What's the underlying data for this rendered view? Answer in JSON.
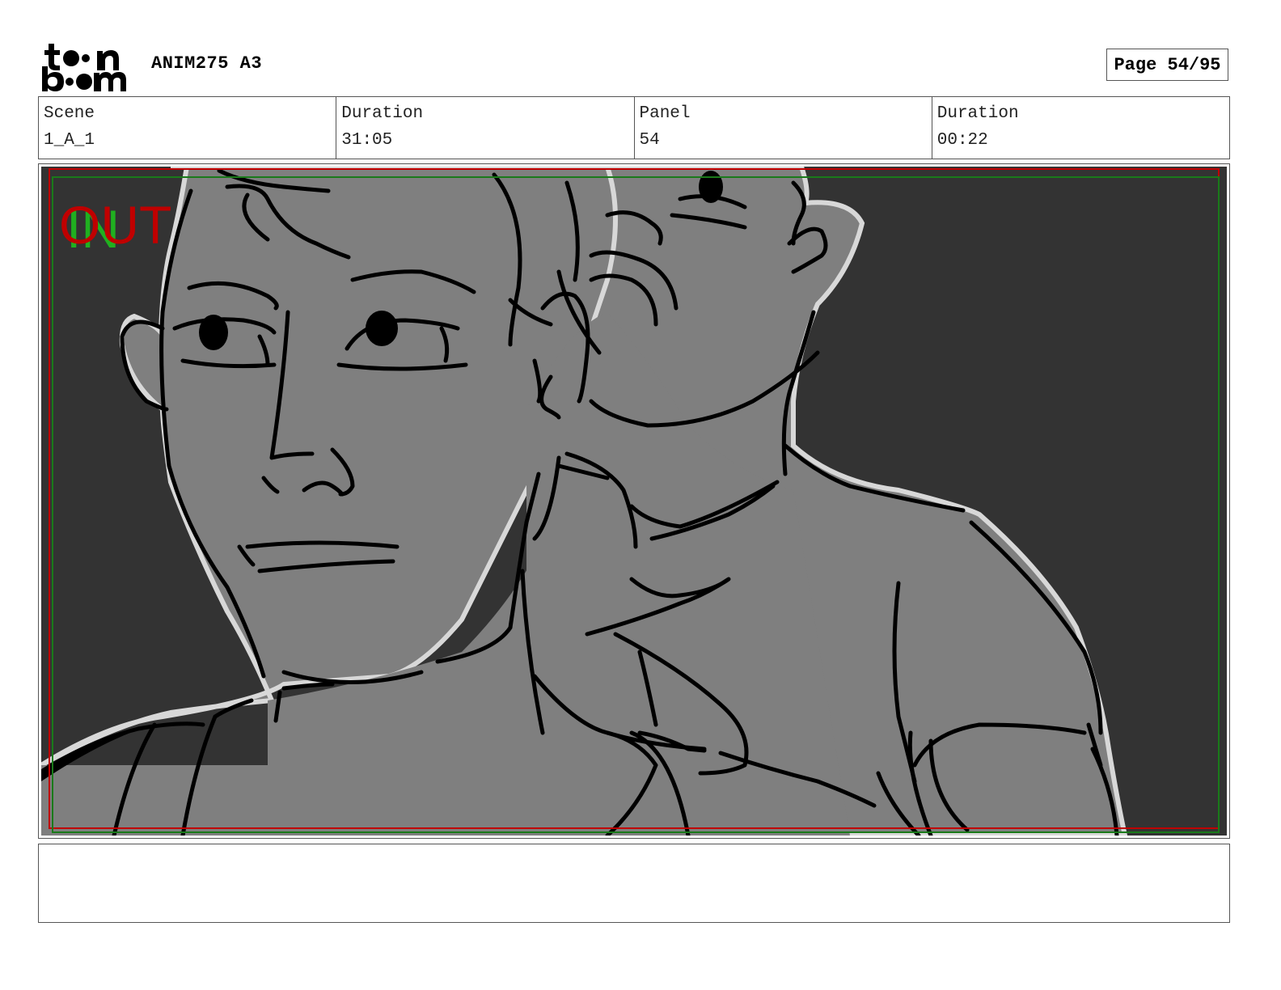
{
  "header": {
    "logo_text_top": "toon",
    "logo_text_bottom": "boom",
    "title": "ANIM275 A3",
    "page_label": "Page 54/95"
  },
  "info": {
    "scene_label": "Scene",
    "scene_value": "1_A_1",
    "scene_duration_label": "Duration",
    "scene_duration_value": "31:05",
    "panel_label": "Panel",
    "panel_value": "54",
    "panel_duration_label": "Duration",
    "panel_duration_value": "00:22"
  },
  "panel": {
    "out_marker": "OUT",
    "in_marker": "IN"
  },
  "notes": {
    "text": ""
  },
  "colors": {
    "background_dark": "#333333",
    "figure_fill": "#7f7f7f",
    "out_frame": "#c00000",
    "in_frame": "#1a7a1a"
  }
}
